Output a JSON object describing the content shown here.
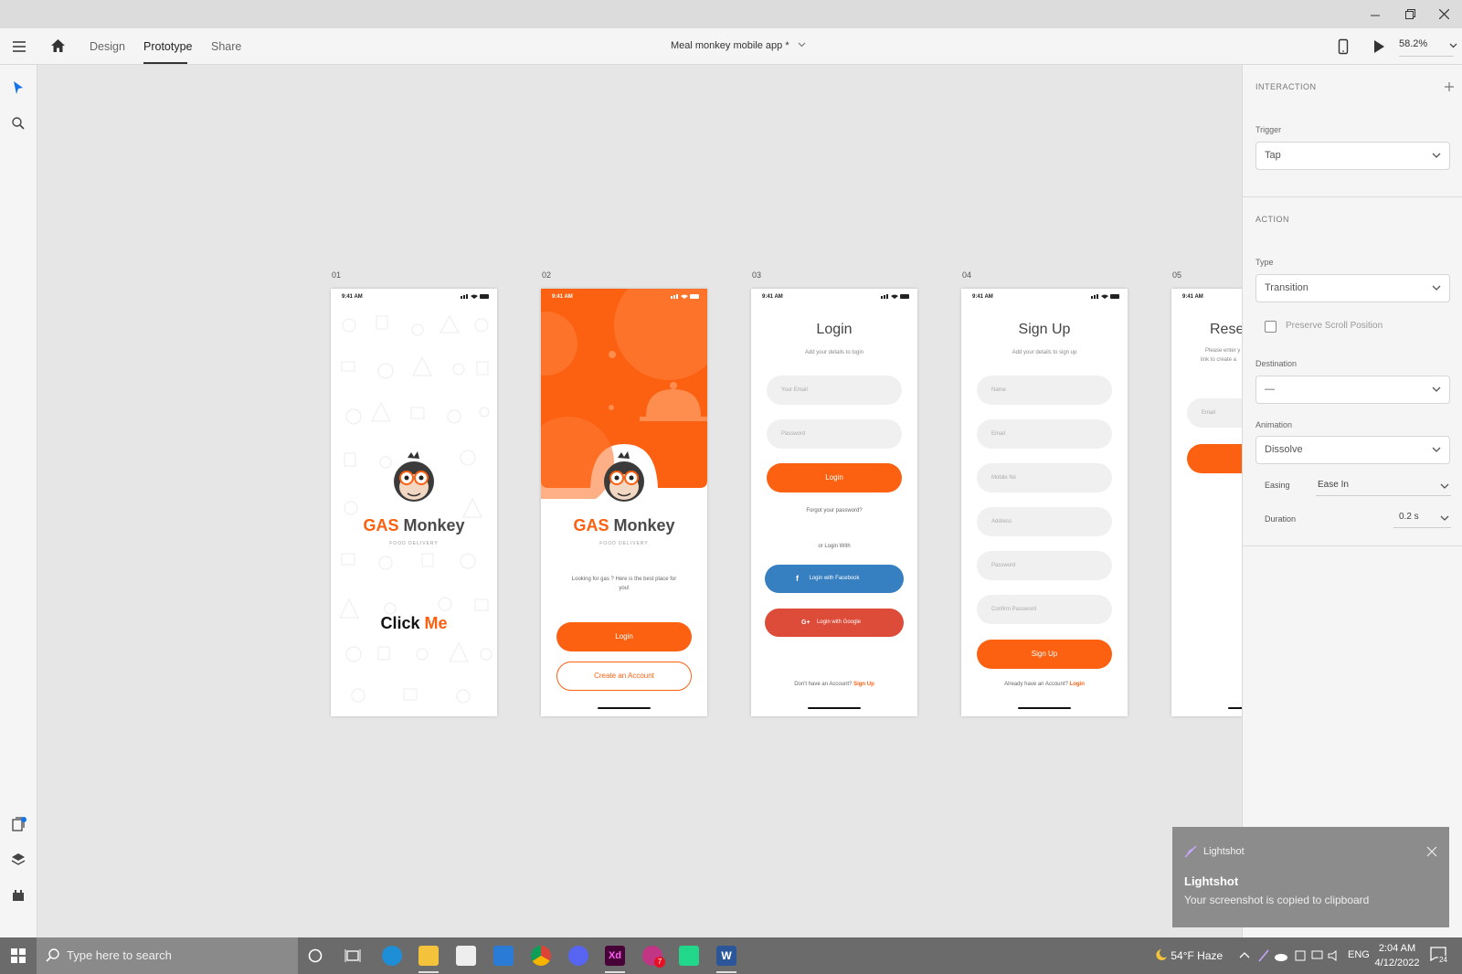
{
  "toolbar": {
    "tabs": [
      "Design",
      "Prototype",
      "Share"
    ],
    "doc_title": "Meal monkey mobile app *",
    "zoom": "58.2%"
  },
  "artboards": {
    "labels": [
      "01",
      "02",
      "03",
      "04",
      "05"
    ],
    "time": "9:41 AM",
    "a1": {
      "brand_a": "GAS",
      "brand_b": "Monkey",
      "tagline": "FOOD DELIVERY",
      "click_a": "Click",
      "click_b": "Me"
    },
    "a2": {
      "brand_a": "GAS",
      "brand_b": "Monkey",
      "tagline": "FOOD DELIVERY",
      "desc": "Looking for gas ? Here is the best place for you!",
      "login": "Login",
      "create": "Create an Account"
    },
    "a3": {
      "title": "Login",
      "subtitle": "Add your details to login",
      "email": "Your Email",
      "password": "Password",
      "login": "Login",
      "forgot": "Forgot your password?",
      "or": "or Login With",
      "facebook": "Login with Facebook",
      "google": "Login with Google",
      "no_account": "Don't have an Account?",
      "signup": "Sign Up"
    },
    "a4": {
      "title": "Sign Up",
      "subtitle": "Add your details to sign up",
      "name": "Name",
      "email": "Email",
      "mobile": "Mobile No",
      "address": "Address",
      "password": "Password",
      "confirm": "Confirm Password",
      "signup": "Sign Up",
      "have_account": "Already have an Account?",
      "login": "Login"
    },
    "a5": {
      "title": "Reset",
      "line1": "Please enter y",
      "line2": "link to create a",
      "email": "Email"
    }
  },
  "panel": {
    "interaction": "INTERACTION",
    "trigger_label": "Trigger",
    "trigger": "Tap",
    "action": "ACTION",
    "type_label": "Type",
    "type": "Transition",
    "preserve": "Preserve Scroll Position",
    "destination_label": "Destination",
    "destination": "—",
    "animation_label": "Animation",
    "animation": "Dissolve",
    "easing_label": "Easing",
    "easing": "Ease In",
    "duration_label": "Duration",
    "duration": "0.2 s"
  },
  "toast": {
    "app": "Lightshot",
    "title": "Lightshot",
    "message": "Your screenshot is copied to clipboard"
  },
  "taskbar": {
    "search": "Type here to search",
    "weather": "54°F  Haze",
    "lang": "ENG",
    "time": "2:04 AM",
    "date": "4/12/2022",
    "notif_count": "24",
    "app_badge": "7"
  },
  "colors": {
    "accent": "#fc6011",
    "facebook": "#367fc0",
    "google": "#dd4b39"
  }
}
